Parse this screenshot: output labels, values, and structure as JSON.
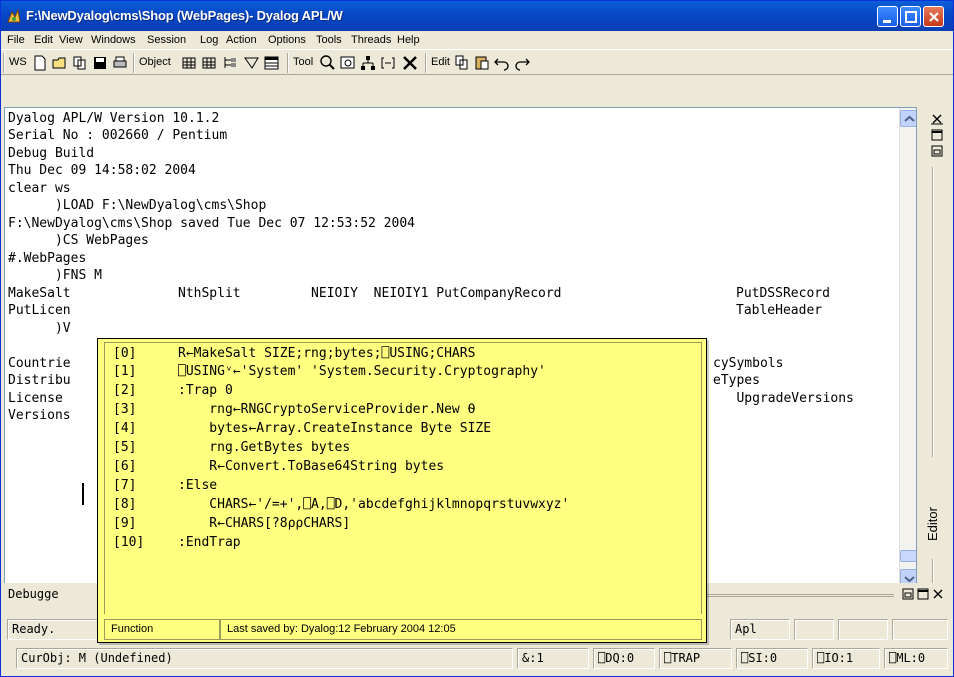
{
  "window": {
    "title": "F:\\NewDyalog\\cms\\Shop (WebPages)- Dyalog APL/W",
    "minimize_icon": "minimize-icon",
    "maximize_icon": "maximize-icon",
    "close_icon": "close-icon"
  },
  "menu": [
    "File",
    "Edit",
    "View",
    "Windows",
    "Session",
    "Log",
    "Action",
    "Options",
    "Tools",
    "Threads",
    "Help"
  ],
  "toolbar": {
    "ws_label": "WS",
    "object_label": "Object",
    "tool_label": "Tool",
    "edit_label": "Edit"
  },
  "session": {
    "lines": [
      "Dyalog APL/W Version 10.1.2",
      "Serial No : 002660 / Pentium",
      "Debug Build",
      "Thu Dec 09 14:58:02 2004",
      "clear ws",
      "      )LOAD F:\\NewDyalog\\cms\\Shop",
      "F:\\NewDyalog\\cms\\Shop saved Tue Dec 07 12:53:52 2004",
      "      )CS WebPages",
      "#.WebPages",
      "      )FNS M"
    ],
    "fns_line_left": "MakeSalt",
    "fns_line_mid": "NthSplit         NEIOIY  NEIOIY1 PutCompanyRecord",
    "fns_line_right": "PutDSSRecord",
    "left_fragments": [
      "PutLicen",
      "      )V",
      "Countrie",
      "Distribu",
      "License",
      "Versions"
    ],
    "right_fragments": [
      "TableHeader",
      "",
      "cySymbols",
      "eTypes",
      "   UpgradeVersions"
    ]
  },
  "tooltip": {
    "lines": [
      {
        "num": "[0]",
        "code": "R←MakeSalt SIZE;rng;bytes;⎕USING;CHARS"
      },
      {
        "num": "[1]",
        "code": "⎕USINGᵛ←'System' 'System.Security.Cryptography'"
      },
      {
        "num": "[2]",
        "code": ":Trap 0"
      },
      {
        "num": "[3]",
        "code": "    rng←RNGCryptoServiceProvider.New ⍬"
      },
      {
        "num": "[4]",
        "code": "    bytes←Array.CreateInstance Byte SIZE"
      },
      {
        "num": "[5]",
        "code": "    rng.GetBytes bytes"
      },
      {
        "num": "[6]",
        "code": "    R←Convert.ToBase64String bytes"
      },
      {
        "num": "[7]",
        "code": ":Else"
      },
      {
        "num": "[8]",
        "code": "    CHARS←'/=+',⎕A,⎕D,'abcdefghijklmnopqrstuvwxyz'"
      },
      {
        "num": "[9]",
        "code": "    R←CHARS[?8⍴⍴CHARS]"
      },
      {
        "num": "[10]",
        "code": ":EndTrap"
      }
    ],
    "status_type": "Function",
    "status_saved": "Last saved by: Dyalog:12 February 2004 12:05"
  },
  "editor_panel": {
    "label": "Editor"
  },
  "debugger": {
    "label": "Debugge"
  },
  "status1": {
    "ready": "Ready.",
    "apl": "Apl"
  },
  "status2": {
    "curobj": "CurObj: M (Undefined)",
    "amp": "&:1",
    "ddq": "⎕DQ:0",
    "trap": "⎕TRAP",
    "si": "⎕SI:0",
    "io": "⎕IO:1",
    "ml": "⎕ML:0"
  }
}
